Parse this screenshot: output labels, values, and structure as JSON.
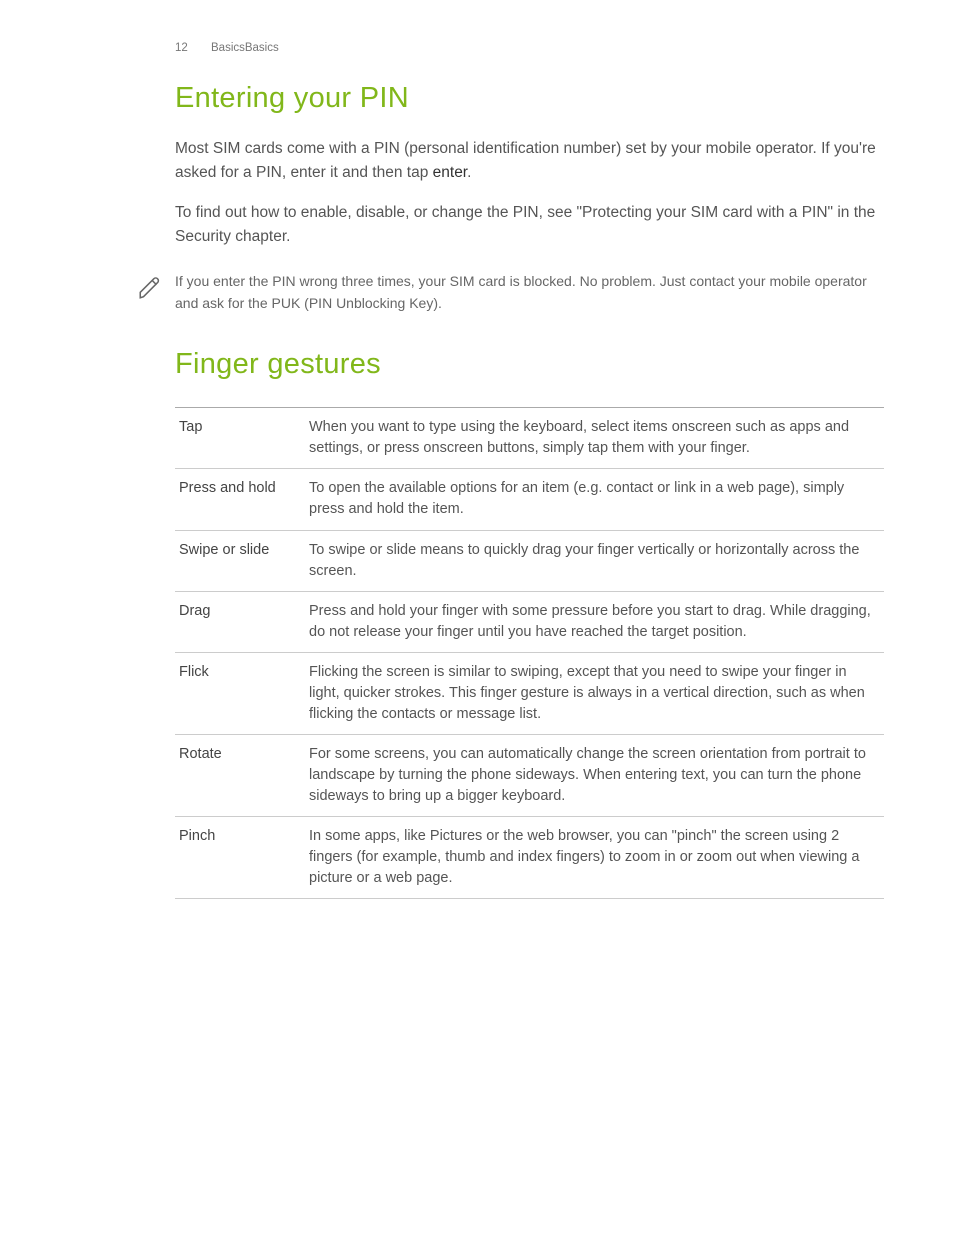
{
  "header": {
    "page_number": "12",
    "breadcrumb": "BasicsBasics"
  },
  "section1": {
    "title": "Entering your PIN",
    "p1_a": "Most SIM cards come with a PIN (personal identification number) set by your mobile operator. If you're asked for a PIN, enter it and then tap ",
    "p1_b": "enter",
    "p1_c": ".",
    "p2": "To find out how to enable, disable, or change the PIN, see \"Protecting your SIM card with a PIN\" in the Security chapter.",
    "note": "If you enter the PIN wrong three times, your SIM card is blocked. No problem. Just contact your mobile operator and ask for the PUK (PIN Unblocking Key)."
  },
  "section2": {
    "title": "Finger gestures",
    "rows": [
      {
        "term": "Tap",
        "desc": "When you want to type using the keyboard, select items onscreen such as apps and settings, or press onscreen buttons, simply tap them with your finger."
      },
      {
        "term": "Press and hold",
        "desc": "To open the available options for an item (e.g. contact or link in a web page), simply press and hold the item."
      },
      {
        "term": "Swipe or slide",
        "desc": "To swipe or slide means to quickly drag your finger vertically or horizontally across the screen."
      },
      {
        "term": "Drag",
        "desc": "Press and hold your finger with some pressure before you start to drag. While dragging, do not release your finger until you have reached the target position."
      },
      {
        "term": "Flick",
        "desc": "Flicking the screen is similar to swiping, except that you need to swipe your finger in light, quicker strokes. This finger gesture is always in a vertical direction, such as when flicking the contacts or message list."
      },
      {
        "term": "Rotate",
        "desc": "For some screens, you can automatically change the screen orientation from portrait to landscape by turning the phone sideways. When entering text, you can turn the phone sideways to bring up a bigger keyboard."
      },
      {
        "term": "Pinch",
        "desc": "In some apps, like Pictures or the web browser, you can \"pinch\" the screen using 2 fingers (for example, thumb and index fingers) to zoom in or zoom out when viewing a picture or a web page."
      }
    ]
  }
}
